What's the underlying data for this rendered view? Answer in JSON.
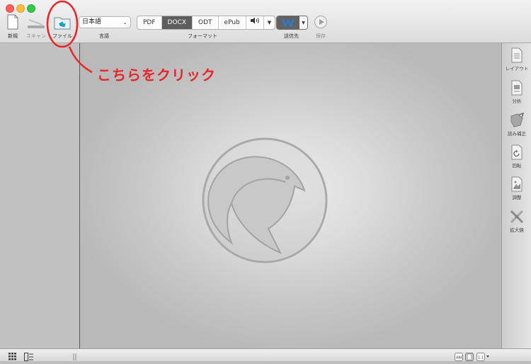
{
  "toolbar": {
    "new_label": "新規",
    "scan_label": "スキャン",
    "file_label": "ファイル",
    "language_value": "日本語",
    "language_label": "言語",
    "format_label": "フォーマット",
    "formats": [
      "PDF",
      "DOCX",
      "ODT",
      "ePub"
    ],
    "active_format": "DOCX",
    "send_label": "送信先",
    "save_label": "保存"
  },
  "right_panel": {
    "items": [
      "レイアウト",
      "分析",
      "読み補正",
      "回転",
      "調整",
      "拡大鏡"
    ]
  },
  "annotation": {
    "text": "こちらをクリック",
    "color": "#e8262a"
  },
  "colors": {
    "active_segment": "#5e5e5e",
    "word_icon": "#2a7bd6"
  }
}
